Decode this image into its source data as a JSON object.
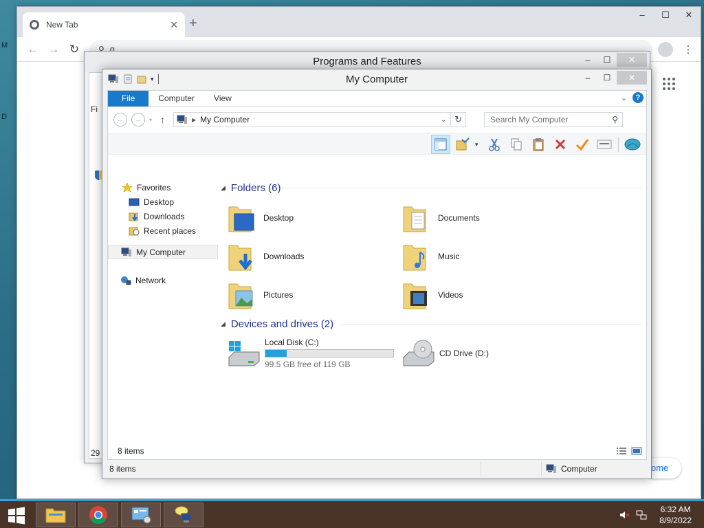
{
  "desktop": {
    "edge_text_1": "M",
    "edge_text_2": "D"
  },
  "chrome": {
    "tab_title": "New Tab",
    "tab_close": "✕",
    "new_tab": "+",
    "window_controls": [
      "–",
      "☐",
      "✕"
    ],
    "omnibox_value": "g",
    "customize_label": "ome"
  },
  "programs_features": {
    "title": "Programs and Features",
    "window_controls": [
      "–",
      "☐",
      "✕"
    ],
    "side_fragment": "Fi",
    "count_fragment": "29"
  },
  "explorer": {
    "title": "My Computer",
    "window_controls": [
      "–",
      "☐",
      "✕"
    ],
    "ribbon_tabs": [
      "File",
      "Computer",
      "View"
    ],
    "address_path": "My Computer",
    "search_placeholder": "Search My Computer",
    "nav": {
      "favorites": "Favorites",
      "desktop": "Desktop",
      "downloads": "Downloads",
      "recent": "Recent places",
      "my_computer": "My Computer",
      "network": "Network"
    },
    "folders_header": "Folders (6)",
    "folders": [
      "Desktop",
      "Documents",
      "Downloads",
      "Music",
      "Pictures",
      "Videos"
    ],
    "devices_header": "Devices and drives (2)",
    "drives": [
      {
        "name": "Local Disk (C:)",
        "free_text": "99.5 GB free of 119 GB",
        "used_fraction": 0.164
      },
      {
        "name": "CD Drive (D:)"
      }
    ],
    "inner_status": "8 items",
    "status_left": "8 items",
    "status_right": "Computer"
  },
  "taskbar": {
    "time": "6:32 AM",
    "date": "8/9/2022"
  }
}
